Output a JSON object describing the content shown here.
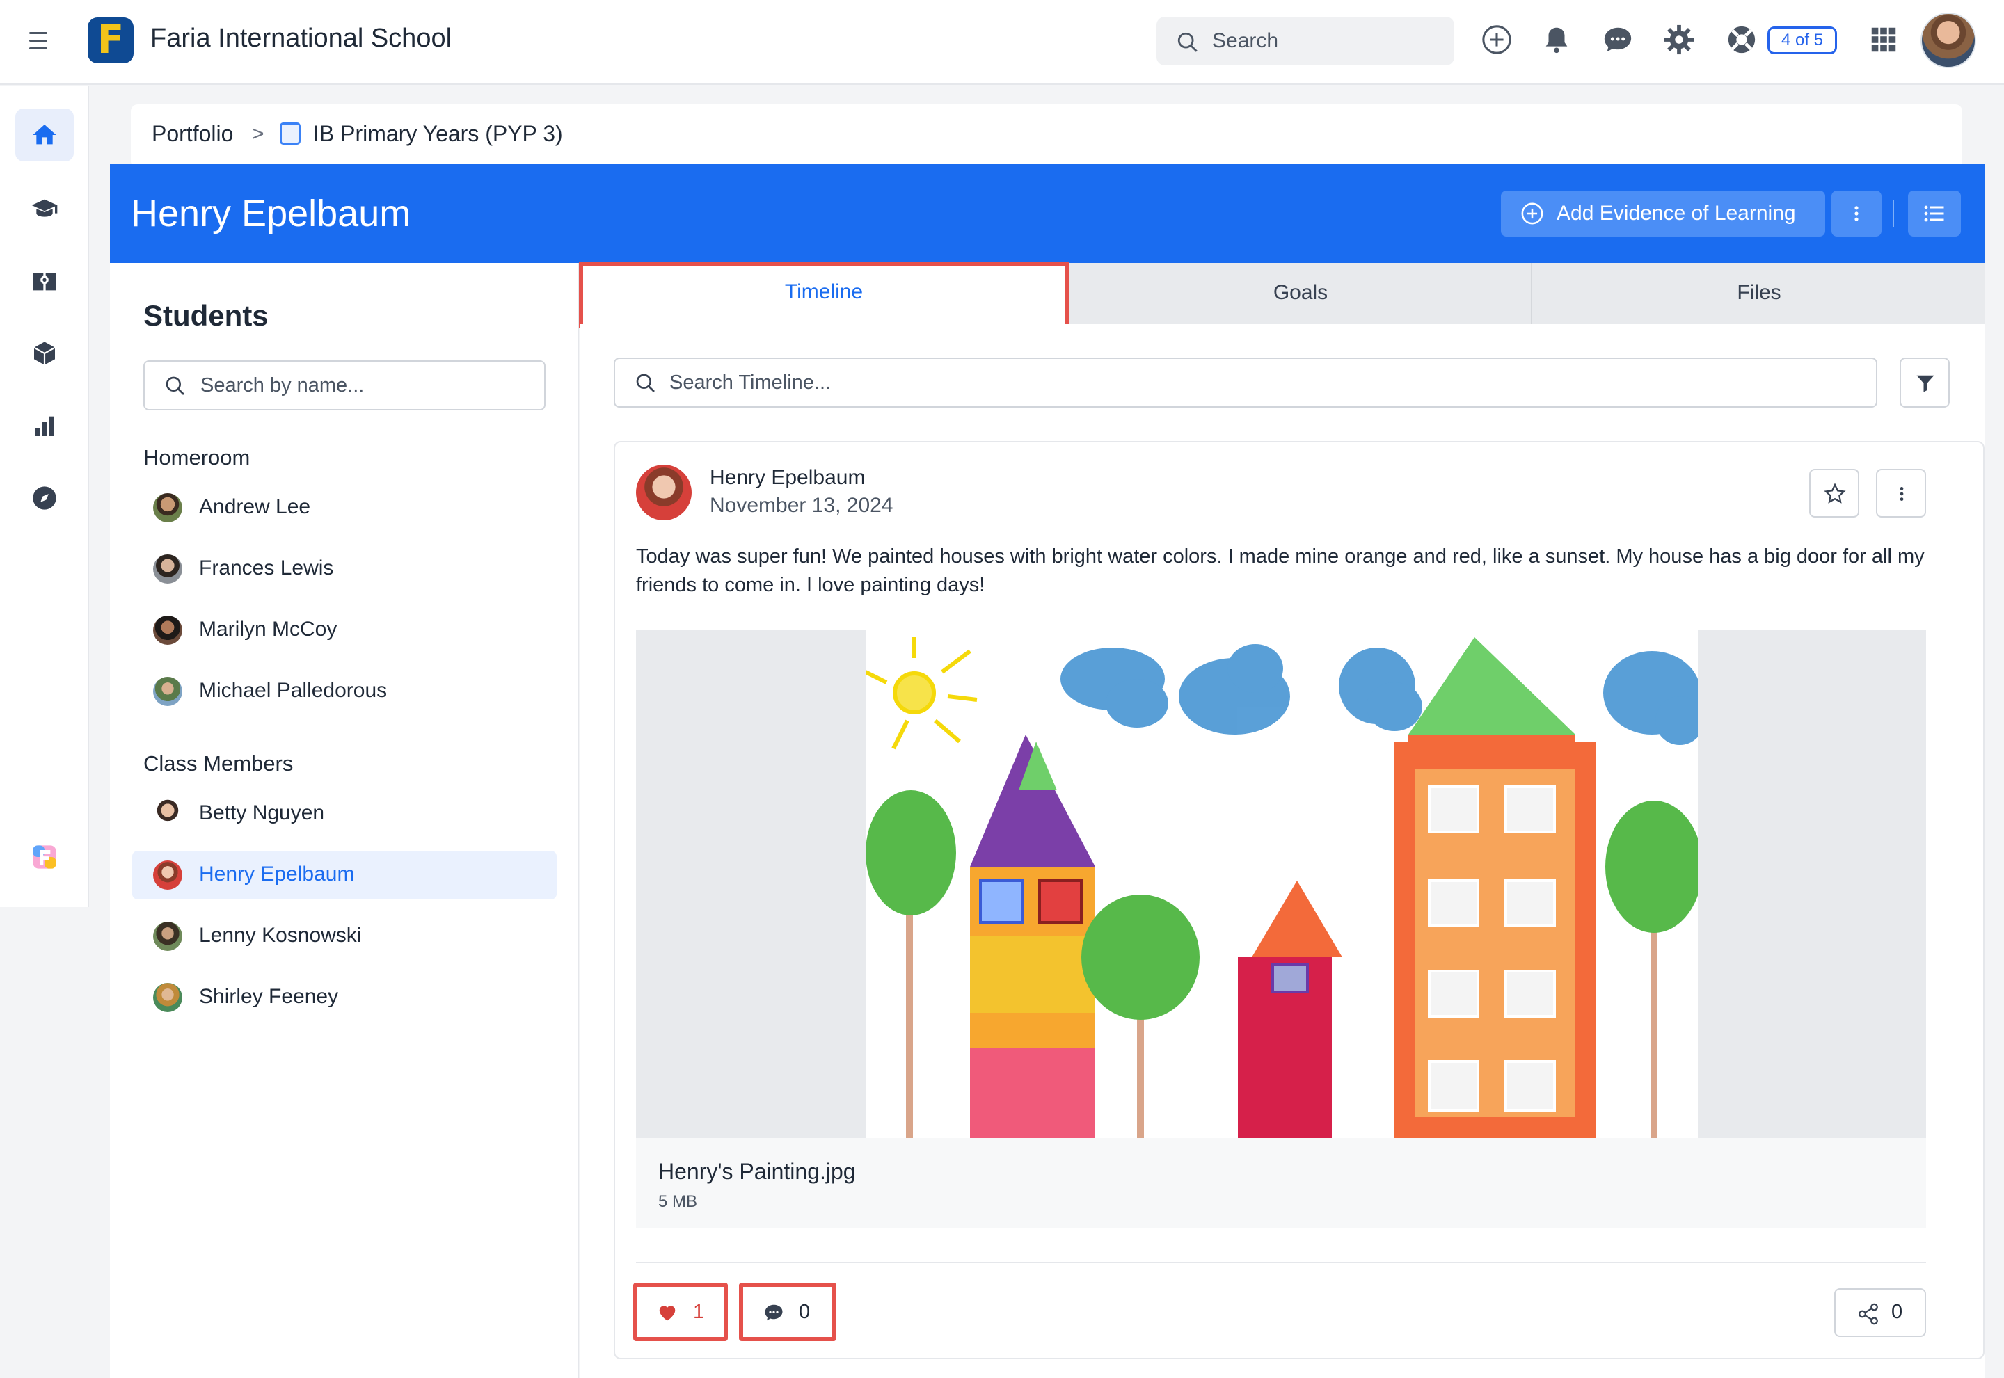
{
  "topbar": {
    "school_name": "Faria International School",
    "search_placeholder": "Search",
    "notif_pill": "4 of 5"
  },
  "breadcrumb": {
    "portfolio": "Portfolio",
    "separator": ">",
    "class_name": "IB Primary Years (PYP 3)"
  },
  "header": {
    "student_name": "Henry Epelbaum",
    "add_evidence_label": "Add Evidence of Learning"
  },
  "sidebar": {
    "title": "Students",
    "search_placeholder": "Search by name...",
    "groups": [
      {
        "label": "Homeroom",
        "students": [
          "Andrew Lee",
          "Frances Lewis",
          "Marilyn McCoy",
          "Michael Palledorous"
        ]
      },
      {
        "label": "Class Members",
        "students": [
          "Betty Nguyen",
          "Henry Epelbaum",
          "Lenny Kosnowski",
          "Shirley Feeney"
        ]
      }
    ],
    "selected_student": "Henry Epelbaum"
  },
  "tabs": [
    {
      "label": "Timeline",
      "active": true
    },
    {
      "label": "Goals",
      "active": false
    },
    {
      "label": "Files",
      "active": false
    }
  ],
  "timeline": {
    "search_placeholder": "Search Timeline...",
    "post": {
      "author": "Henry Epelbaum",
      "date": "November 13, 2024",
      "text": "Today was super fun! We painted houses with bright water colors. I made mine orange and red, like a sunset. My house has a big door for all my friends to come in. I love painting days!",
      "file_name": "Henry's Painting.jpg",
      "file_size": "5 MB",
      "likes": "1",
      "comments": "0",
      "shares": "0"
    }
  },
  "colors": {
    "brand_blue": "#1a6cf0",
    "highlight_red": "#e5514b",
    "like_red": "#d6403a"
  },
  "icons": [
    "menu-icon",
    "search-icon",
    "plus-circle-icon",
    "bell-icon",
    "chat-icon",
    "gear-icon",
    "help-icon",
    "apps-grid-icon",
    "home-icon",
    "graduation-cap-icon",
    "book-icon",
    "cube-icon",
    "bar-chart-icon",
    "compass-icon",
    "faria-logo-icon",
    "chevron-right-icon",
    "calendar-icon",
    "more-vertical-icon",
    "list-icon",
    "filter-icon",
    "star-icon",
    "heart-icon",
    "comment-icon",
    "share-icon"
  ]
}
